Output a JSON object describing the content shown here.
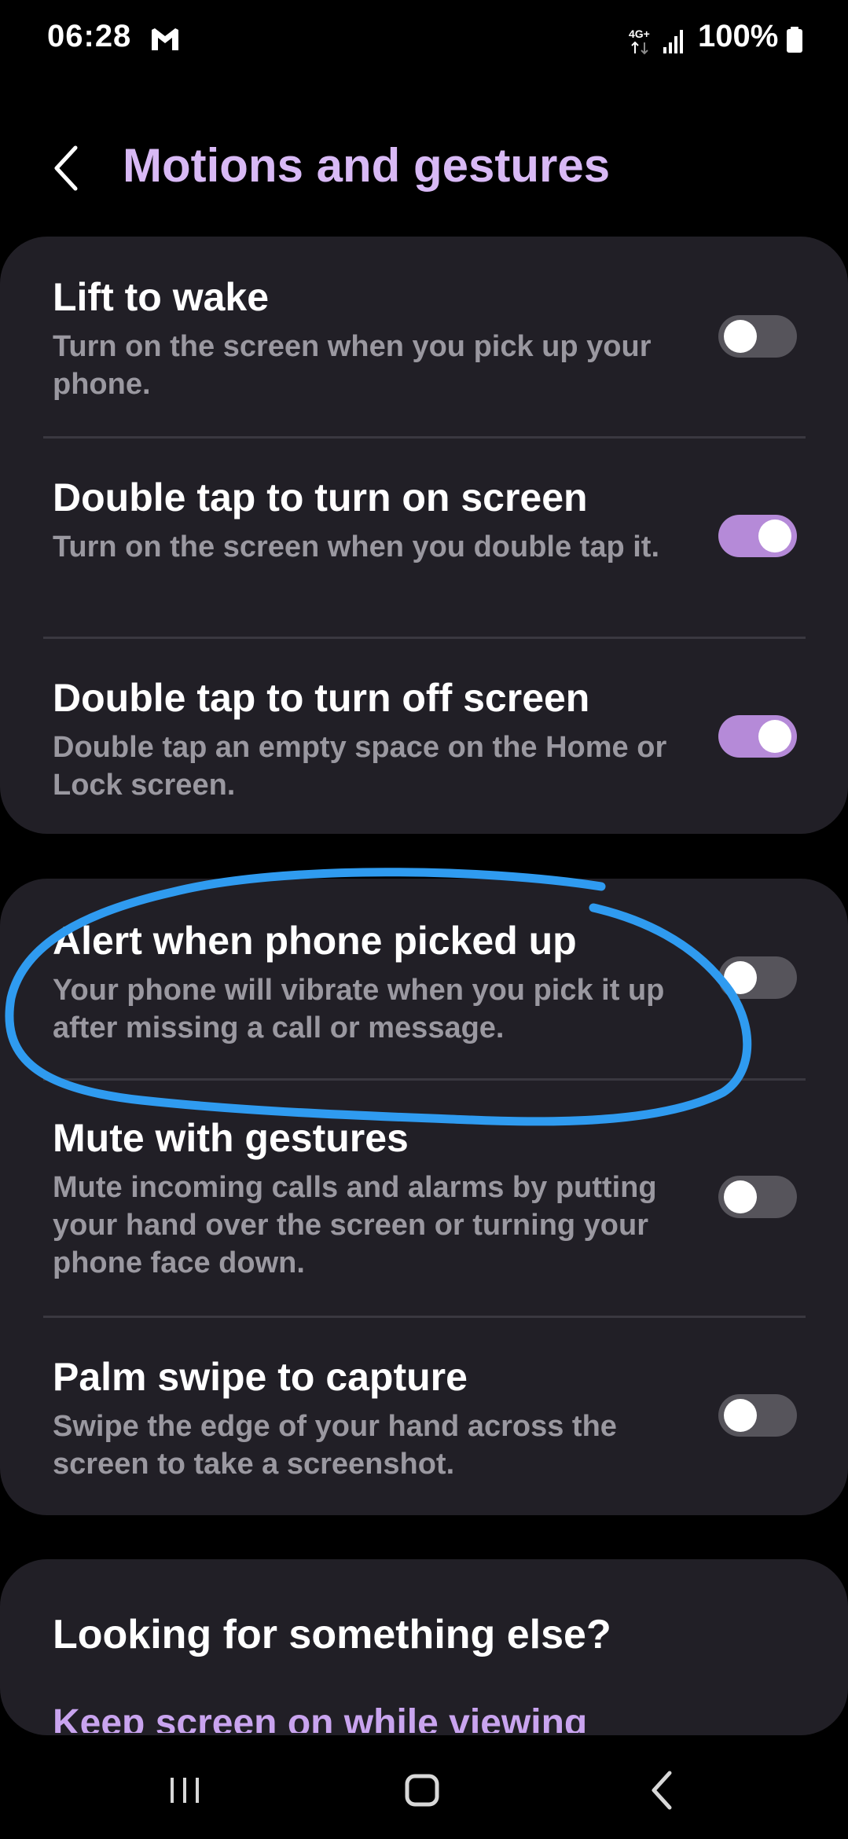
{
  "status_bar": {
    "time": "06:28",
    "battery": "100%",
    "network_label": "4G+",
    "icons": [
      "gmail-icon",
      "network-icon",
      "signal-icon",
      "battery-icon"
    ]
  },
  "header": {
    "title": "Motions and gestures",
    "back_icon": "chevron-left-icon"
  },
  "colors": {
    "accent": "#b58ad8",
    "title": "#d8b9f5",
    "card_bg": "#211f26",
    "annotation": "#2f9bf0"
  },
  "settings": [
    {
      "title": "Lift to wake",
      "description": "Turn on the screen when you pick up your phone.",
      "enabled": false
    },
    {
      "title": "Double tap to turn on screen",
      "description": "Turn on the screen when you double tap it.",
      "enabled": true
    },
    {
      "title": "Double tap to turn off screen",
      "description": "Double tap an empty space on the Home or Lock screen.",
      "enabled": true
    },
    {
      "title": "Alert when phone picked up",
      "description": "Your phone will vibrate when you pick it up after missing a call or message.",
      "enabled": false
    },
    {
      "title": "Mute with gestures",
      "description": "Mute incoming calls and alarms by putting your hand over the screen or turning your phone face down.",
      "enabled": false
    },
    {
      "title": "Palm swipe to capture",
      "description": "Swipe the edge of your hand across the screen to take a screenshot.",
      "enabled": false
    }
  ],
  "suggestions": {
    "heading": "Looking for something else?",
    "link": "Keep screen on while viewing"
  },
  "nav_bar": {
    "icons": [
      "recents-icon",
      "home-icon",
      "back-icon"
    ]
  }
}
